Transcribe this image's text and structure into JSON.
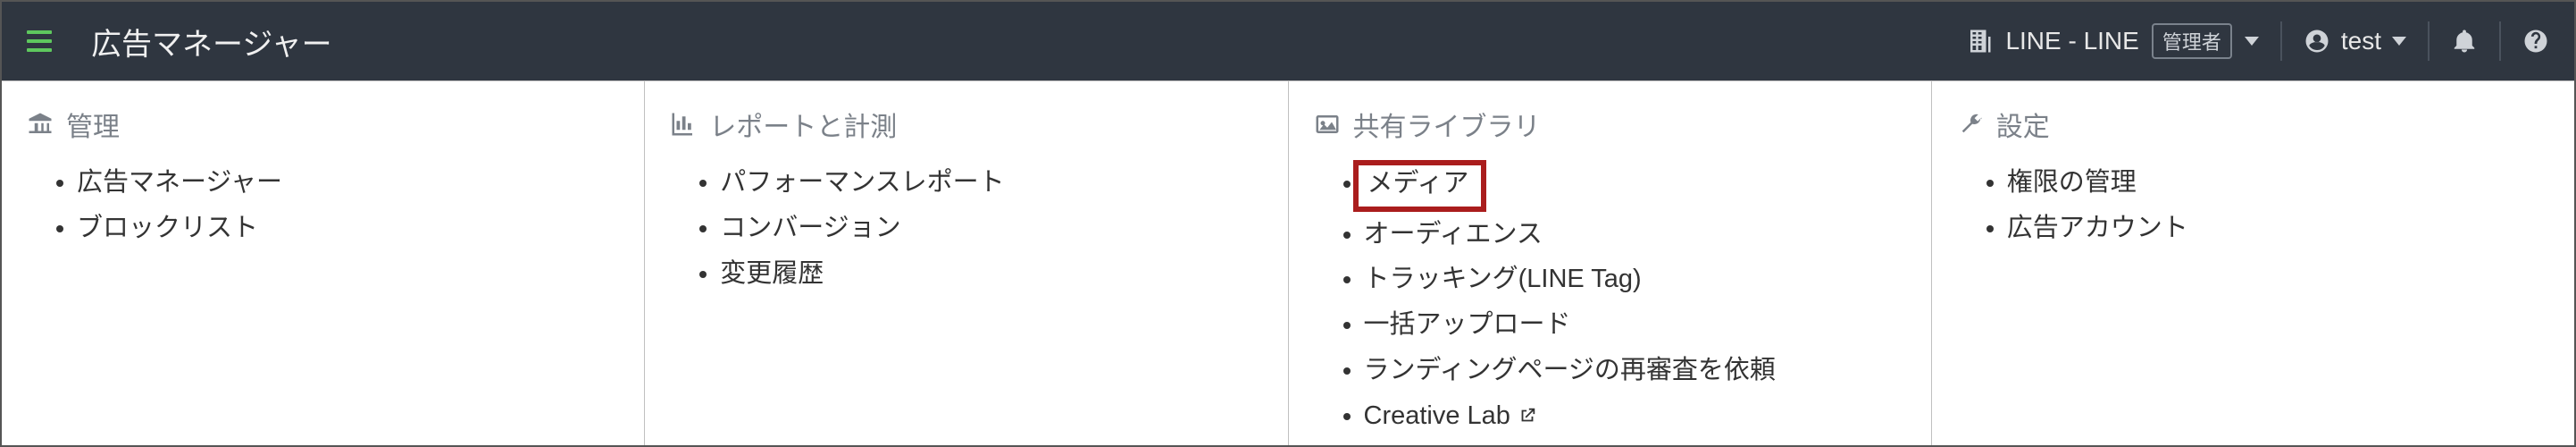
{
  "header": {
    "app_title": "広告マネージャー",
    "account_name": "LINE - LINE",
    "role_label": "管理者",
    "user_name": "test"
  },
  "columns": [
    {
      "title": "管理",
      "icon": "institution-icon",
      "items": [
        {
          "label": "広告マネージャー",
          "highlight": false,
          "external": false
        },
        {
          "label": "ブロックリスト",
          "highlight": false,
          "external": false
        }
      ]
    },
    {
      "title": "レポートと計測",
      "icon": "chart-icon",
      "items": [
        {
          "label": "パフォーマンスレポート",
          "highlight": false,
          "external": false
        },
        {
          "label": "コンバージョン",
          "highlight": false,
          "external": false
        },
        {
          "label": "変更履歴",
          "highlight": false,
          "external": false
        }
      ]
    },
    {
      "title": "共有ライブラリ",
      "icon": "image-icon",
      "items": [
        {
          "label": "メディア",
          "highlight": true,
          "external": false
        },
        {
          "label": "オーディエンス",
          "highlight": false,
          "external": false
        },
        {
          "label": "トラッキング(LINE Tag)",
          "highlight": false,
          "external": false
        },
        {
          "label": "一括アップロード",
          "highlight": false,
          "external": false
        },
        {
          "label": "ランディングページの再審査を依頼",
          "highlight": false,
          "external": false
        },
        {
          "label": "Creative Lab",
          "highlight": false,
          "external": true
        }
      ]
    },
    {
      "title": "設定",
      "icon": "wrench-icon",
      "items": [
        {
          "label": "権限の管理",
          "highlight": false,
          "external": false
        },
        {
          "label": "広告アカウント",
          "highlight": false,
          "external": false
        }
      ]
    }
  ]
}
